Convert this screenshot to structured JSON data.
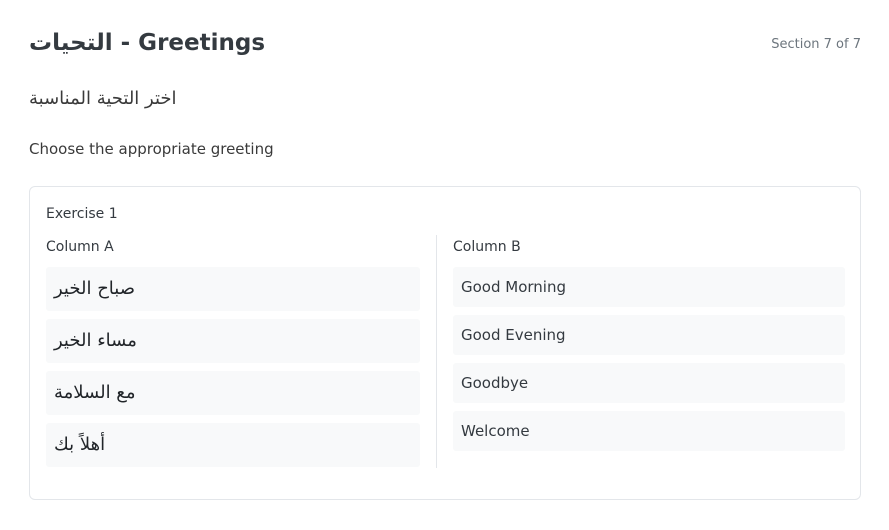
{
  "header": {
    "title": "التحيات - Greetings",
    "section": "Section 7 of 7"
  },
  "instructions": {
    "arabic": "اختر التحية المناسبة",
    "english": "Choose the appropriate greeting"
  },
  "exercise": {
    "title": "Exercise 1",
    "column_a": {
      "header": "Column A",
      "items": [
        "صباح الخير",
        "مساء الخير",
        "مع السلامة",
        "أهلاً بك"
      ]
    },
    "column_b": {
      "header": "Column B",
      "items": [
        "Good Morning",
        "Good Evening",
        "Goodbye",
        "Welcome"
      ]
    }
  }
}
